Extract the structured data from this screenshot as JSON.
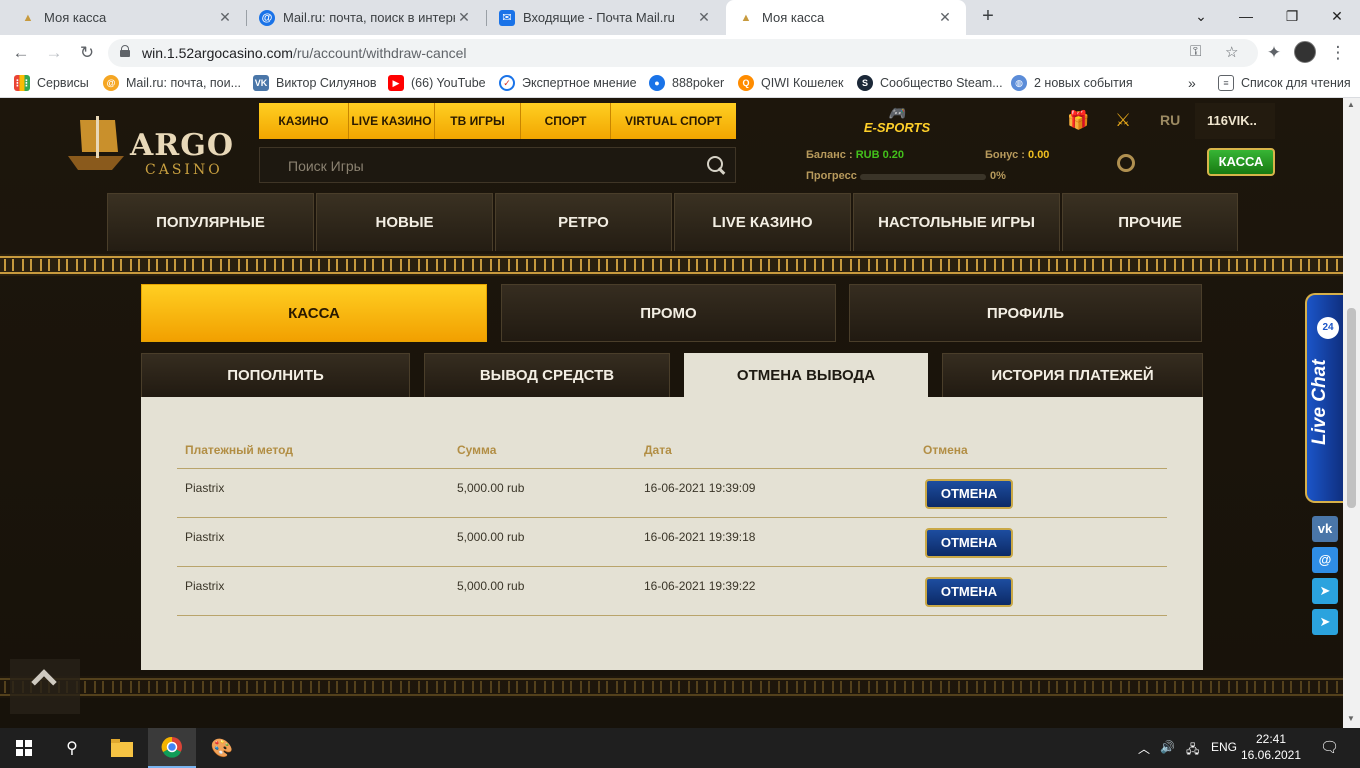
{
  "browser": {
    "tabs": [
      {
        "title": "Моя касса",
        "active": false
      },
      {
        "title": "Mail.ru: почта, поиск в интернете",
        "active": false
      },
      {
        "title": "Входящие - Почта Mail.ru",
        "active": false
      },
      {
        "title": "Моя касса",
        "active": true
      }
    ],
    "url_host": "win.1.52argocasino.com",
    "url_path": "/ru/account/withdraw-cancel",
    "bookmarks": [
      {
        "label": "Сервисы",
        "icon": "apps-grid-icon",
        "color": "#ea4335"
      },
      {
        "label": "Mail.ru: почта, пои...",
        "icon": "mailru-at-icon",
        "color": "#f5a623"
      },
      {
        "label": "Виктор Силуянов",
        "icon": "vk-icon",
        "color": "#4a76a8"
      },
      {
        "label": "(66) YouTube",
        "icon": "youtube-icon",
        "color": "#ff0000"
      },
      {
        "label": "Экспертное мнение",
        "icon": "check-circle-icon",
        "color": "#d93025"
      },
      {
        "label": "888poker",
        "icon": "888poker-icon",
        "color": "#1a73e8"
      },
      {
        "label": "QIWI Кошелек",
        "icon": "qiwi-icon",
        "color": "#ff8c00"
      },
      {
        "label": "Сообщество Steam...",
        "icon": "steam-icon",
        "color": "#1b2838"
      },
      {
        "label": "2 новых события",
        "icon": "globe-icon",
        "color": "#5b8cd8"
      }
    ],
    "bookmarks_overflow": "»",
    "reading_list": "Список для чтения"
  },
  "site": {
    "logo_main": "ARGO",
    "logo_sub": "CASINO",
    "top_menu": [
      "КАЗИНО",
      "LIVE КАЗИНО",
      "ТВ ИГРЫ",
      "СПОРТ",
      "VIRTUAL СПОРТ"
    ],
    "esports": "E-SPORTS",
    "lang": "RU",
    "username": "116VIK..",
    "search_placeholder": "Поиск Игры",
    "balance_label": "Баланс :",
    "balance_value": "RUB 0.20",
    "bonus_label": "Бонус :",
    "bonus_value": "0.00",
    "progress_label": "Прогресс",
    "progress_value": "0%",
    "progress_fraction": 0,
    "kassa_button": "КАССА",
    "categories": [
      "ПОПУЛЯРНЫЕ",
      "НОВЫЕ",
      "РЕТРО",
      "LIVE КАЗИНО",
      "НАСТОЛЬНЫЕ ИГРЫ",
      "ПРОЧИЕ"
    ],
    "account_tabs": [
      "КАССА",
      "ПРОМО",
      "ПРОФИЛЬ"
    ],
    "sub_tabs": [
      "ПОПОЛНИТЬ",
      "ВЫВОД СРЕДСТВ",
      "ОТМЕНА ВЫВОДА",
      "ИСТОРИЯ ПЛАТЕЖЕЙ"
    ],
    "table": {
      "headers": [
        "Платежный метод",
        "Сумма",
        "Дата",
        "Отмена"
      ],
      "rows": [
        {
          "method": "Piastrix",
          "amount": "5,000.00 rub",
          "date": "16-06-2021 19:39:09",
          "action": "ОТМЕНА"
        },
        {
          "method": "Piastrix",
          "amount": "5,000.00 rub",
          "date": "16-06-2021 19:39:18",
          "action": "ОТМЕНА"
        },
        {
          "method": "Piastrix",
          "amount": "5,000.00 rub",
          "date": "16-06-2021 19:39:22",
          "action": "ОТМЕНА"
        }
      ]
    },
    "live_chat": "Live Chat",
    "live_chat_badge": "24",
    "social": [
      "vk-icon",
      "mailru-at-icon",
      "telegram-icon",
      "telegram-icon"
    ],
    "colors": {
      "gold": "#ffcf22",
      "panel": "#e4e1d4",
      "cancel_blue": "#1d4da0",
      "green": "#43c11b"
    }
  },
  "taskbar": {
    "lang": "ENG",
    "time": "22:41",
    "date": "16.06.2021"
  }
}
